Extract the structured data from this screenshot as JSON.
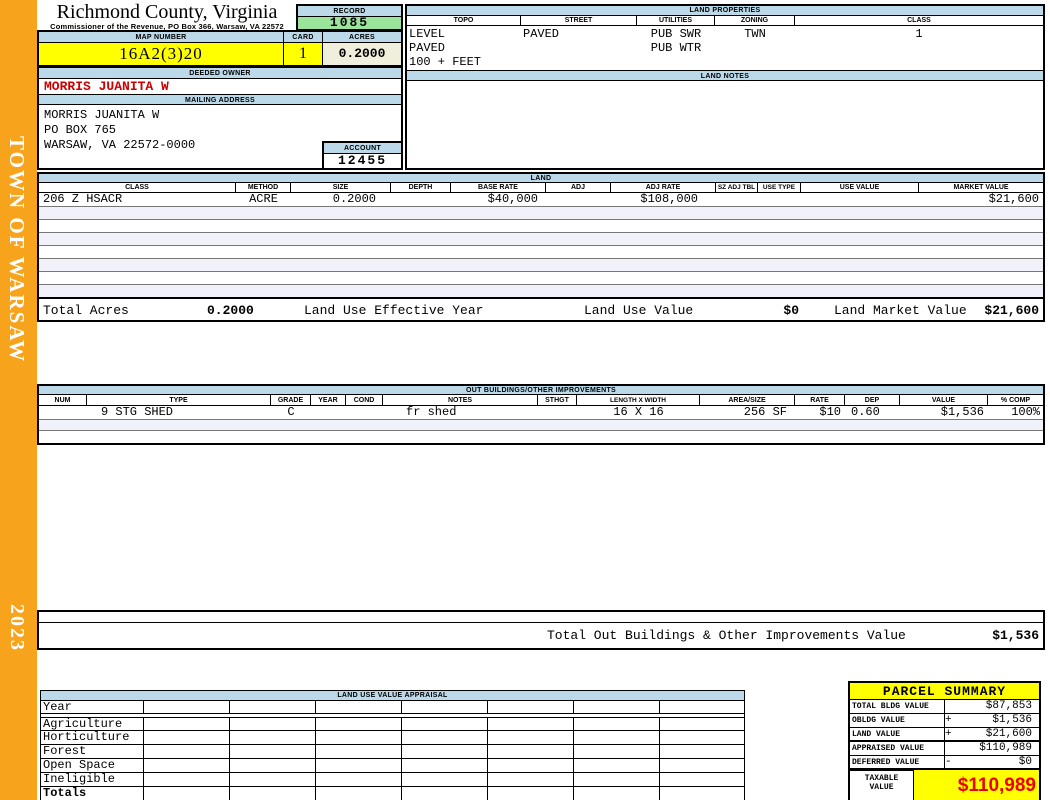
{
  "county": {
    "title": "Richmond County, Virginia",
    "subtitle": "Commissioner of the Revenue, PO Box 366, Warsaw, VA 22572"
  },
  "sidebar": {
    "town": "TOWN OF WARSAW",
    "year": "2023"
  },
  "record": {
    "label": "RECORD",
    "value": "1085"
  },
  "map": {
    "label": "MAP NUMBER",
    "value": "16A2(3)20"
  },
  "card": {
    "label": "CARD",
    "value": "1"
  },
  "acres": {
    "label": "ACRES",
    "value": "0.2000"
  },
  "owner": {
    "label": "DEEDED OWNER",
    "value": "MORRIS JUANITA W"
  },
  "mailing": {
    "label": "MAILING ADDRESS",
    "lines": [
      "MORRIS JUANITA W",
      "PO BOX 765",
      "",
      "WARSAW, VA 22572-0000"
    ]
  },
  "account": {
    "label": "ACCOUNT",
    "value": "12455"
  },
  "land_properties": {
    "title": "LAND PROPERTIES",
    "columns": [
      "TOPO",
      "STREET",
      "UTILITIES",
      "ZONING",
      "CLASS"
    ],
    "topo": [
      "LEVEL",
      "PAVED",
      "100 + FEET"
    ],
    "street": [
      "PAVED"
    ],
    "utilities": [
      "PUB SWR",
      "PUB WTR"
    ],
    "zoning": [
      "TWN"
    ],
    "class_val": [
      "1"
    ]
  },
  "land_notes": {
    "title": "LAND NOTES"
  },
  "land": {
    "title": "LAND",
    "columns": [
      "CLASS",
      "METHOD",
      "SIZE",
      "DEPTH",
      "BASE RATE",
      "ADJ",
      "ADJ RATE",
      "SZ ADJ TBL",
      "USE TYPE",
      "USE VALUE",
      "MARKET VALUE"
    ],
    "row": {
      "class_code": "206 Z HSACR",
      "method": "ACRE",
      "size": "0.2000",
      "depth": "",
      "base_rate": "$40,000",
      "adj": "",
      "adj_rate": "$108,000",
      "sz_adj_tbl": "",
      "use_type": "",
      "use_value": "",
      "market_value": "$21,600"
    },
    "totals": {
      "total_acres_label": "Total Acres",
      "total_acres": "0.2000",
      "effective_year_label": "Land Use Effective Year",
      "use_value_label": "Land Use Value",
      "use_value": "$0",
      "market_value_label": "Land Market Value",
      "market_value": "$21,600"
    }
  },
  "out_buildings": {
    "title": "OUT BUILDINGS/OTHER IMPROVEMENTS",
    "columns": [
      "NUM",
      "TYPE",
      "GRADE",
      "YEAR",
      "COND",
      "NOTES",
      "STHGT",
      "LENGTH X WIDTH",
      "AREA/SIZE",
      "RATE",
      "DEP",
      "VALUE",
      "% COMP"
    ],
    "row": {
      "num": "",
      "type": "9 STG SHED",
      "grade": "C",
      "year": "",
      "cond": "",
      "notes": "fr shed",
      "sthgt": "",
      "length_width": "16 X 16",
      "area": "256 SF",
      "rate": "$10",
      "dep": "0.60",
      "value": "$1,536",
      "comp": "100%"
    },
    "total_label": "Total Out Buildings & Other Improvements Value",
    "total_value": "$1,536"
  },
  "land_use_appraisal": {
    "title": "LAND USE VALUE APPRAISAL",
    "row_labels": [
      "Year",
      "Agriculture",
      "Horticulture",
      "Forest",
      "Open Space",
      "Ineligible",
      "Totals"
    ]
  },
  "parcel_summary": {
    "title": "PARCEL SUMMARY",
    "rows": [
      {
        "label": "TOTAL BLDG VALUE",
        "sign": "",
        "value": "$87,853"
      },
      {
        "label": "OBLDG VALUE",
        "sign": "+",
        "value": "$1,536"
      },
      {
        "label": "LAND VALUE",
        "sign": "+",
        "value": "$21,600"
      },
      {
        "label": "APPRAISED VALUE",
        "sign": "",
        "value": "$110,989"
      },
      {
        "label": "DEFERRED VALUE",
        "sign": "-",
        "value": "$0"
      }
    ],
    "taxable": {
      "label_line1": "TAXABLE",
      "label_line2": "VALUE",
      "value": "$110,989"
    }
  },
  "colors": {
    "accent_orange": "#F7A31C",
    "header_blue": "#BCD9E9",
    "record_green": "#9BE49B",
    "highlight_yellow": "#FFFF00",
    "acres_cream": "#F0EFDC",
    "owner_red": "#CC0000",
    "taxable_red": "#EE0000"
  }
}
